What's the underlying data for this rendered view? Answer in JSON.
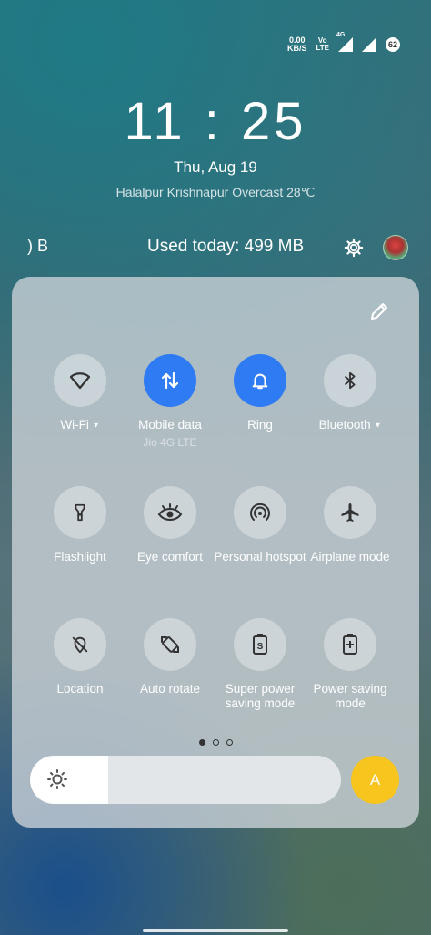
{
  "status_bar": {
    "speed_value": "0.00",
    "speed_unit": "KB/S",
    "volte_top": "Vo",
    "volte_bottom": "LTE",
    "network": "4G",
    "battery_level": "62"
  },
  "lockscreen": {
    "time": "11 : 25",
    "date": "Thu, Aug 19",
    "weather": "Halalpur Krishnapur Overcast 28℃"
  },
  "data_usage": {
    "left_text": ") B",
    "used_today": "Used today: 499 MB"
  },
  "tiles": [
    {
      "label": "Wi-Fi",
      "icon": "wifi-icon",
      "active": false,
      "dropdown": true
    },
    {
      "label": "Mobile data",
      "sub": "Jio 4G LTE",
      "icon": "mobile-data-icon",
      "active": true
    },
    {
      "label": "Ring",
      "icon": "bell-icon",
      "active": true
    },
    {
      "label": "Bluetooth",
      "icon": "bluetooth-icon",
      "active": false,
      "dropdown": true
    },
    {
      "label": "Flashlight",
      "icon": "flashlight-icon",
      "active": false
    },
    {
      "label": "Eye comfort",
      "icon": "eye-icon",
      "active": false
    },
    {
      "label": "Personal hotspot",
      "icon": "hotspot-icon",
      "active": false
    },
    {
      "label": "Airplane mode",
      "icon": "airplane-icon",
      "active": false
    },
    {
      "label": "Location",
      "icon": "location-off-icon",
      "active": false
    },
    {
      "label": "Auto rotate",
      "icon": "auto-rotate-icon",
      "active": false
    },
    {
      "label": "Super power saving mode",
      "icon": "super-power-saving-icon",
      "active": false
    },
    {
      "label": "Power saving mode",
      "icon": "power-saving-icon",
      "active": false
    }
  ],
  "pager": {
    "pages": 3,
    "current": 0
  },
  "brightness": {
    "level": 0.25,
    "auto_label": "A"
  },
  "colors": {
    "accent": "#2f7bf3",
    "auto_button": "#f7c51e"
  }
}
